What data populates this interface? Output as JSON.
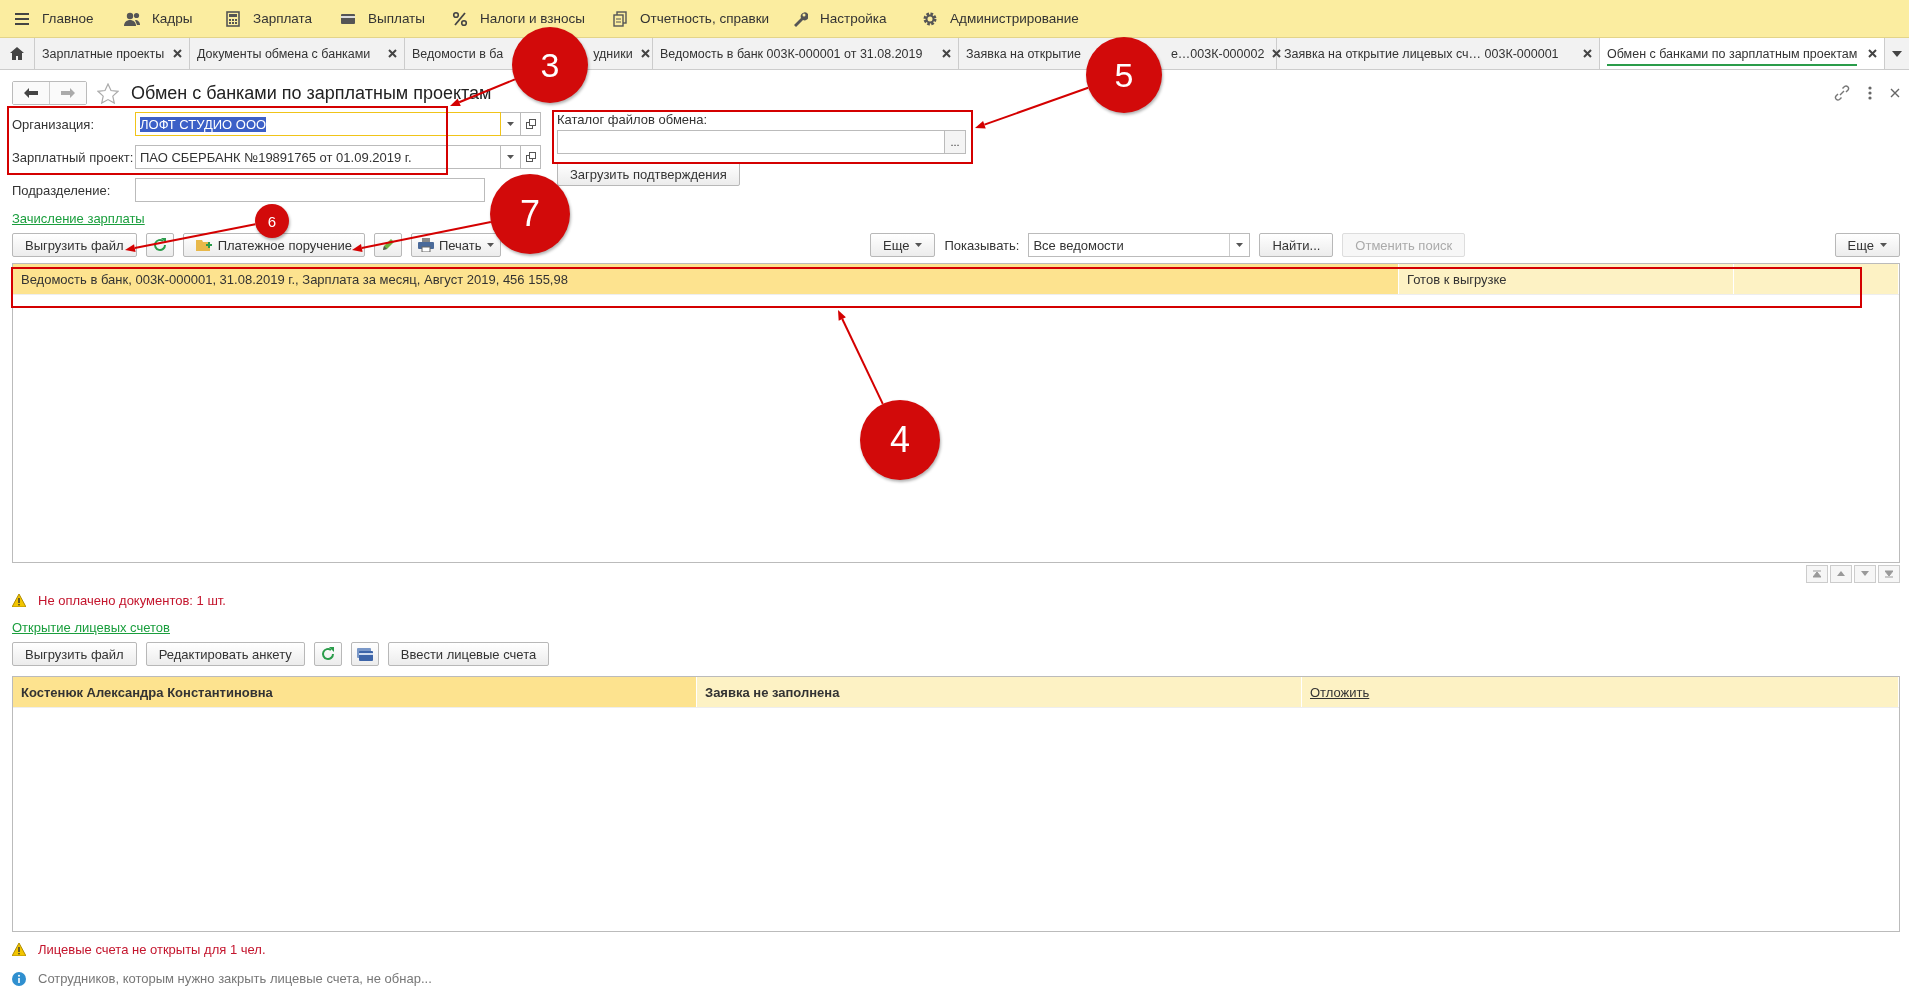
{
  "menu": [
    {
      "label": "Главное"
    },
    {
      "label": "Кадры"
    },
    {
      "label": "Зарплата"
    },
    {
      "label": "Выплаты"
    },
    {
      "label": "Налоги и взносы"
    },
    {
      "label": "Отчетность, справки"
    },
    {
      "label": "Настройка"
    },
    {
      "label": "Администрирование"
    }
  ],
  "tabs": [
    {
      "label": "Зарплатные проекты",
      "selected": false
    },
    {
      "label": "Документы обмена с банками",
      "selected": false
    },
    {
      "label": "Ведомости в ба",
      "label_end": "удники",
      "selected": false
    },
    {
      "label": "Ведомость в банк 003К-000001 от 31.08.2019",
      "selected": false
    },
    {
      "label": "Заявка на открытие",
      "label_end": "е…003К-000002",
      "selected": false
    },
    {
      "label": "Заявка на открытие лицевых сч…  003К-000001",
      "selected": false
    },
    {
      "label": "Обмен с банками по зарплатным проектам",
      "selected": true
    }
  ],
  "window": {
    "title": "Обмен с банками по зарплатным проектам"
  },
  "fields": [
    {
      "label": "Организация:",
      "value": "ЛОФТ СТУДИО ООО",
      "focused": true
    },
    {
      "label": "Зарплатный проект:",
      "value": "ПАО СБЕРБАНК №19891765 от 01.09.2019 г.",
      "focused": false
    },
    {
      "label": "Подразделение:",
      "focused": false
    }
  ],
  "exchange_folder": {
    "label": "Каталог файлов обмена:",
    "button": "...",
    "load_button": "Загрузить подтверждения"
  },
  "payroll": {
    "link": "Зачисление зарплаты",
    "toolbar": {
      "export": "Выгрузить файл",
      "payment": "Платежное поручение",
      "print": "Печать",
      "more": "Еще",
      "show_label": "Показывать:",
      "show_value": "Все ведомости",
      "find": "Найти...",
      "cancel_search": "Отменить поиск",
      "cancel_disabled": true,
      "more_right": "Еще"
    },
    "rows": [
      {
        "document": "Ведомость в банк, 003К-000001, 31.08.2019 г., Зарплата за месяц, Август 2019, 456 155,98",
        "status": "Готов к выгрузке",
        "selected": true
      }
    ],
    "warning": "Не оплачено документов: 1 шт."
  },
  "accounts": {
    "link": "Открытие лицевых счетов",
    "toolbar": {
      "export": "Выгрузить файл",
      "edit": "Редактировать анкету",
      "enter": "Ввести лицевые счета"
    },
    "rows": [
      {
        "employee": "Костенюк Александра Константиновна",
        "status": "Заявка не заполнена",
        "action": "Отложить",
        "selected": true
      }
    ],
    "warning": "Лицевые счета не открыты для 1 чел.",
    "info": "Сотрудников, которым нужно закрыть лицевые счета, не обнар..."
  },
  "callouts": [
    {
      "number": "3"
    },
    {
      "number": "5"
    },
    {
      "number": "4"
    },
    {
      "number": "6"
    },
    {
      "number": "7"
    }
  ]
}
